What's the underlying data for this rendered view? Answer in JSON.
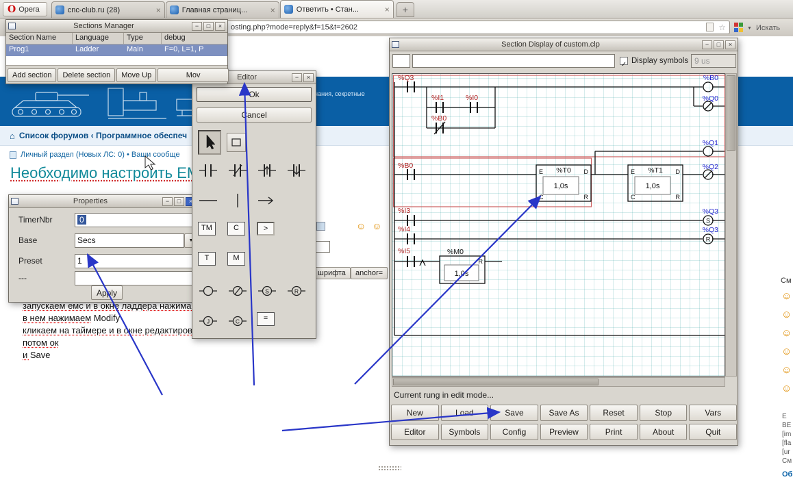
{
  "colors": {
    "arrow": "#2936c8",
    "label_red": "#b02020",
    "label_blue": "#2427cf",
    "banner_blue": "#0a5fa5",
    "selection_blue": "#7d90c0"
  },
  "browser": {
    "menu_label": "Opera",
    "tabs": [
      "cnc-club.ru (28)",
      "Главная страниц...",
      "Ответить • Стан..."
    ],
    "address_visible": "osting.php?mode=reply&f=15&t=2602",
    "search_label": "Искать"
  },
  "sections_manager": {
    "title": "Sections Manager",
    "columns": [
      "Section Name",
      "Language",
      "Type",
      "debug"
    ],
    "row": [
      "Prog1",
      "Ladder",
      "Main",
      "F=0, L=1, P"
    ],
    "buttons": [
      "Add section",
      "Delete section",
      "Move Up",
      "Mov"
    ]
  },
  "properties": {
    "title": "Properties",
    "rows": [
      {
        "label": "TimerNbr",
        "value": "0"
      },
      {
        "label": "Base",
        "value": "Secs"
      },
      {
        "label": "Preset",
        "value": "1"
      },
      {
        "label": "---",
        "value": ""
      }
    ],
    "apply_label": "Apply"
  },
  "editor": {
    "title": "Editor",
    "ok_label": "Ok",
    "cancel_label": "Cancel",
    "symbols": {
      "tm": "TM",
      "counter": "C",
      "gt": ">",
      "t": "T",
      "m": "M",
      "s": "S",
      "r": "R",
      "j": "J",
      "call": "C",
      "eq": "="
    }
  },
  "section_display": {
    "title": "Section Display of custom.clp",
    "display_symbols_label": "Display symbols",
    "scan_time": "9 us",
    "status": "Current rung in edit mode...",
    "buttons_row1": [
      "New",
      "Load",
      "Save",
      "Save As",
      "Reset",
      "Stop",
      "Vars"
    ],
    "buttons_row2": [
      "Editor",
      "Symbols",
      "Config",
      "Preview",
      "Print",
      "About",
      "Quit"
    ],
    "ladder": {
      "c_q3": "%Q3",
      "c_i1": "%I1",
      "c_i0": "%I0",
      "c_b0nc": "%B0",
      "c_b0": "%B0",
      "c_i3": "%I3",
      "c_i4": "%I4",
      "c_i5": "%I5",
      "coil_b0": "%B0",
      "coil_q0": "%Q0",
      "coil_q1": "%Q1",
      "coil_q2": "%Q2",
      "coil_q3s": "%Q3",
      "coil_q3r": "%Q3",
      "t0": "%T0",
      "t1": "%T1",
      "m0": "%M0",
      "t0_val": "1,0s",
      "t1_val": "1,0s",
      "m0_val": "1,0s",
      "pin_e": "E",
      "pin_d": "D",
      "pin_c": "C",
      "pin_r": "R",
      "s_letter": "S",
      "r_letter": "R"
    }
  },
  "forum": {
    "banner_caption": "знания, секретные",
    "breadcrumb": "Список форумов ‹ Программное обеспеч",
    "userbar": "Личный раздел (Новых ЛС: 0) • Ваши сообще",
    "topic_title": "Необходимо настроить EMC",
    "toolbar_buttons": [
      "шрифта",
      "anchor="
    ],
    "smilies_header": "См",
    "message_lines": [
      [
        {
          "t": "запускаем емс и в окне ладдера нажимае",
          "u": true
        }
      ],
      [
        {
          "t": "в нем нажимаем",
          "u": true
        },
        {
          "t": " Modify",
          "u": false
        }
      ],
      [
        {
          "t": "кликаем на таймере и в окне редактирован",
          "u": true
        }
      ],
      [
        {
          "t": "потом ок",
          "u": true
        }
      ],
      [
        {
          "t": "и ",
          "u": true
        },
        {
          "t": "Save",
          "u": false
        }
      ]
    ],
    "sidebar_fragments": [
      "Е",
      "ВЕ",
      "[im",
      "[fla",
      "[ur",
      "См",
      "Об"
    ]
  }
}
